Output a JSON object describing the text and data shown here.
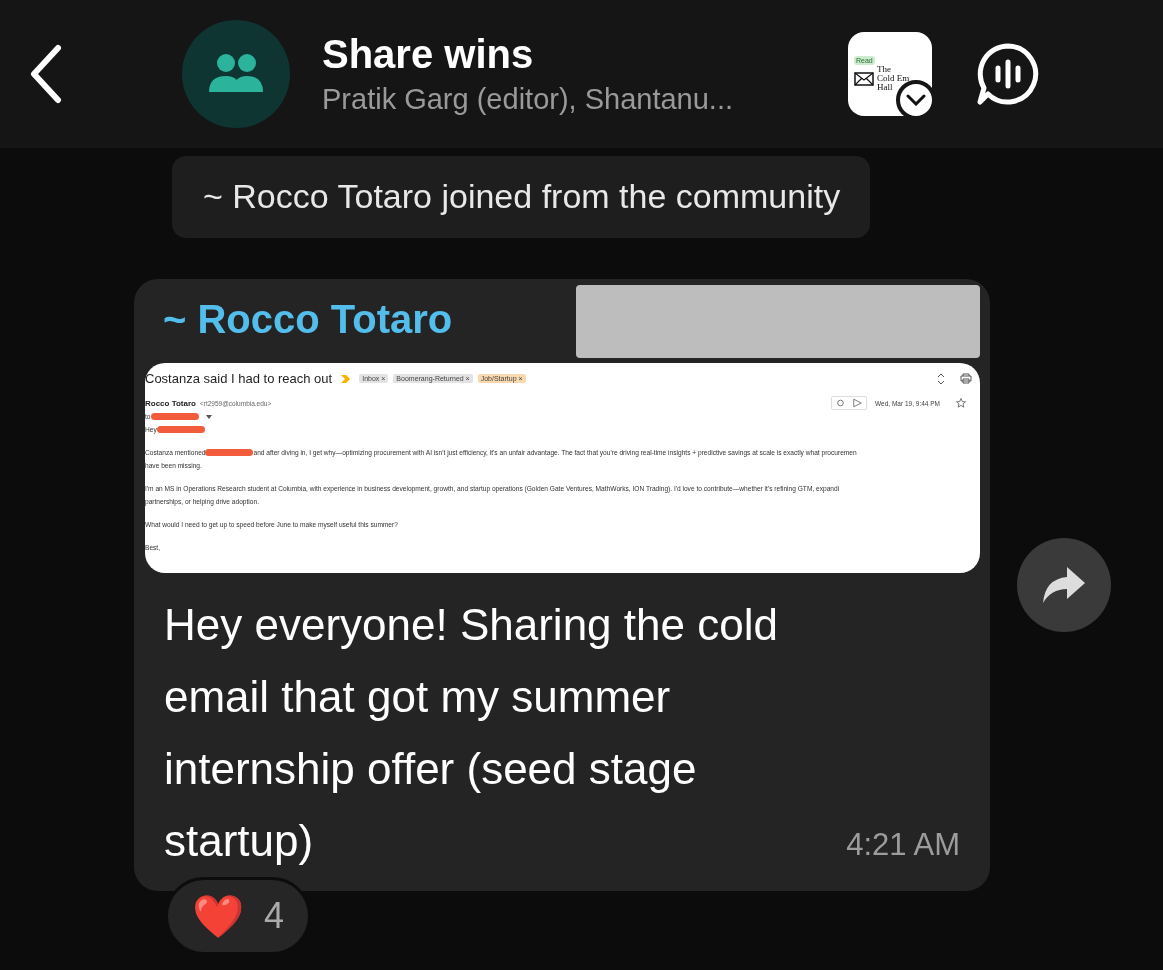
{
  "header": {
    "title": "Share wins",
    "subtitle": "Pratik Garg (editor), Shantanu...",
    "logo": {
      "badge": "Read",
      "lines": [
        "The",
        "Cold Em",
        "Hall"
      ]
    }
  },
  "system_message": "~ Rocco Totaro joined from the community",
  "message": {
    "sender": "~ Rocco Totaro",
    "email": {
      "subject": "Costanza said I had to reach out",
      "labels": [
        {
          "text": "Inbox ×",
          "color": "#e3e3e3"
        },
        {
          "text": "Boomerang-Returned ×",
          "color": "#e3e3e3"
        },
        {
          "text": "Job/Startup ×",
          "color": "#fbd9b0"
        }
      ],
      "from_name": "Rocco Totaro",
      "from_email": "<rt2959@columbia.edu>",
      "date": "Wed, Mar 19, 9:44 PM",
      "lines": [
        [
          {
            "kind": "text",
            "text": "to"
          },
          {
            "kind": "redaction"
          },
          {
            "kind": "caret"
          }
        ],
        [
          {
            "kind": "text",
            "text": "Hey"
          },
          {
            "kind": "redaction"
          }
        ],
        [
          {
            "kind": "gap"
          }
        ],
        [
          {
            "kind": "text",
            "text": "Costanza mentioned"
          },
          {
            "kind": "redaction"
          },
          {
            "kind": "text",
            "text": "and after diving in, I get why—optimizing procurement with AI isn't just efficiency, it's an unfair advantage. The fact that you're driving real-time insights + predictive savings at scale is exactly what procuremen"
          }
        ],
        [
          {
            "kind": "text",
            "text": "have been missing."
          }
        ],
        [
          {
            "kind": "gap"
          }
        ],
        [
          {
            "kind": "text",
            "text": "I'm an MS in Operations Research student at Columbia, with experience in business development, growth, and startup operations (Golden Gate Ventures, MathWorks, ION Trading). I'd love to contribute—whether it's refining GTM, expandi"
          }
        ],
        [
          {
            "kind": "text",
            "text": "partnerships, or helping drive adoption."
          }
        ],
        [
          {
            "kind": "gap"
          }
        ],
        [
          {
            "kind": "text",
            "text": "What would I need to get up to speed before June to make myself useful this summer?"
          }
        ],
        [
          {
            "kind": "gap"
          }
        ],
        [
          {
            "kind": "text",
            "text": "Best,"
          }
        ]
      ]
    },
    "text": "Hey everyone! Sharing the cold email that got my summer internship offer (seed stage startup)",
    "time": "4:21 AM",
    "reaction": {
      "emoji": "❤️",
      "count": "4"
    }
  }
}
